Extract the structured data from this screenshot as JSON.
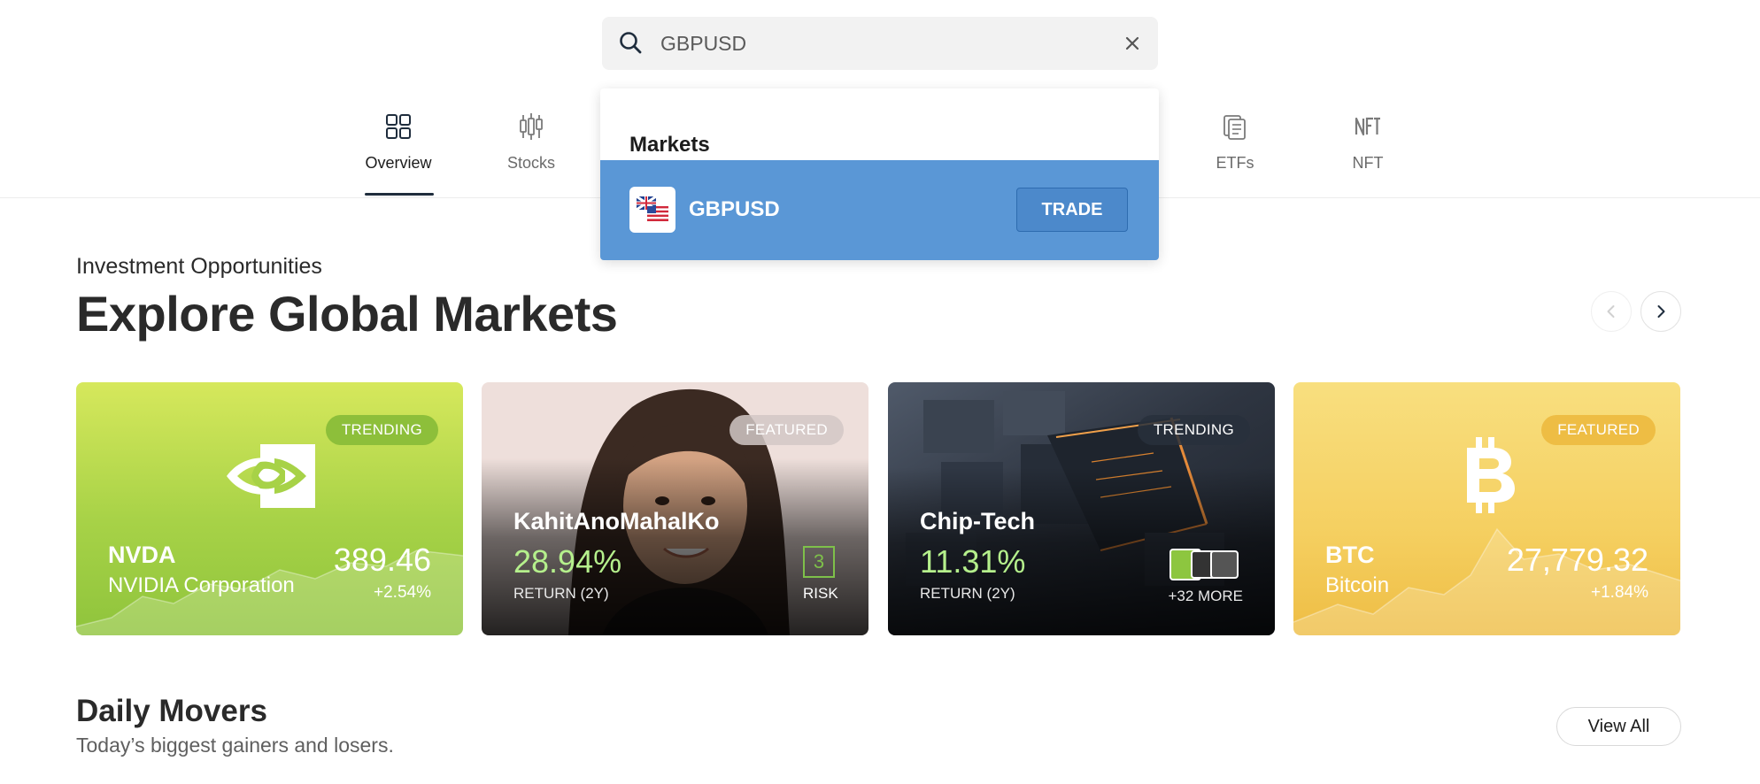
{
  "search": {
    "value": "GBPUSD",
    "icon": "search-icon",
    "clear_icon": "close-icon"
  },
  "dropdown": {
    "section_title": "Markets",
    "results": [
      {
        "symbol": "GBPUSD",
        "action": "TRADE",
        "icon": "gbp-usd-flag-icon"
      }
    ]
  },
  "nav": {
    "tabs": [
      {
        "label": "Overview",
        "icon": "grid-icon",
        "active": true
      },
      {
        "label": "Stocks",
        "icon": "candlestick-icon",
        "active": false
      },
      {
        "label": "ETFs",
        "icon": "documents-icon",
        "active": false
      },
      {
        "label": "NFT",
        "icon": "nft-icon",
        "active": false
      }
    ]
  },
  "section": {
    "eyebrow": "Investment Opportunities",
    "title": "Explore Global Markets"
  },
  "cards": [
    {
      "badge": "TRENDING",
      "title": "NVDA",
      "subtitle": "NVIDIA Corporation",
      "price": "389.46",
      "change": "+2.54%",
      "color": "#a7d247"
    },
    {
      "badge": "FEATURED",
      "title": "KahitAnoMahalKo",
      "return": "28.94%",
      "return_label": "RETURN (2Y)",
      "risk": "3",
      "risk_label": "RISK"
    },
    {
      "badge": "TRENDING",
      "title": "Chip-Tech",
      "return": "11.31%",
      "return_label": "RETURN (2Y)",
      "more": "+32 MORE"
    },
    {
      "badge": "FEATURED",
      "title": "BTC",
      "subtitle": "Bitcoin",
      "price": "27,779.32",
      "change": "+1.84%",
      "color": "#f5cf60"
    }
  ],
  "daily_movers": {
    "title": "Daily Movers",
    "subtitle": "Today’s biggest gainers and losers.",
    "view_all": "View All"
  }
}
